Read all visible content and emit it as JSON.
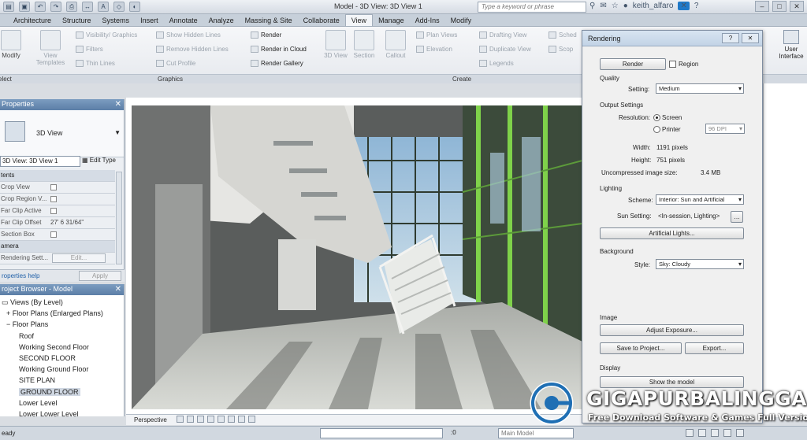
{
  "window": {
    "title": "Model - 3D View: 3D View 1",
    "search_placeholder": "Type a keyword or phrase",
    "user": "keith_alfaro"
  },
  "ribbon": {
    "tabs": [
      "Architecture",
      "Structure",
      "Systems",
      "Insert",
      "Annotate",
      "Analyze",
      "Massing & Site",
      "Collaborate",
      "View",
      "Manage",
      "Add-Ins",
      "Modify"
    ],
    "active_tab": "View",
    "left_cut": [
      "Modify",
      "elect"
    ],
    "graphics": {
      "label": "Graphics",
      "view_templates": "View Templates",
      "visibility": "Visibility/ Graphics",
      "filters": "Filters",
      "thin_lines": "Thin Lines",
      "show_hidden": "Show Hidden Lines",
      "remove_hidden": "Remove Hidden Lines",
      "cut_profile": "Cut Profile"
    },
    "render": {
      "render": "Render",
      "render_cloud": "Render in Cloud",
      "render_gallery": "Render Gallery"
    },
    "create": {
      "label": "Create",
      "view3d": "3D View",
      "section": "Section",
      "callout": "Callout",
      "plan_views": "Plan Views",
      "elevation": "Elevation",
      "drafting_view": "Drafting View",
      "duplicate_view": "Duplicate View",
      "legends": "Legends",
      "sched": "Sched",
      "scope": "Scop"
    },
    "user_interface": "User Interface"
  },
  "properties": {
    "title": "Properties",
    "type_name": "3D View",
    "view_selector": "3D View: 3D View 1",
    "edit_type": "Edit Type",
    "rows": [
      {
        "label": "tents",
        "kind": "cat"
      },
      {
        "label": "Crop View",
        "kind": "check"
      },
      {
        "label": "Crop Region V...",
        "kind": "check"
      },
      {
        "label": "Far Clip Active",
        "kind": "check"
      },
      {
        "label": "Far Clip Offset",
        "kind": "value",
        "value": "27' 6 31/64\""
      },
      {
        "label": "Section Box",
        "kind": "check"
      },
      {
        "label": "amera",
        "kind": "cat"
      },
      {
        "label": "Rendering Sett...",
        "kind": "button",
        "value": "Edit..."
      }
    ],
    "help_link": "roperties help",
    "apply": "Apply"
  },
  "browser": {
    "title": "roject Browser - Model",
    "items": [
      {
        "label": "Views (By Level)",
        "indent": 0,
        "prefix": "▭"
      },
      {
        "label": "Floor Plans (Enlarged Plans)",
        "indent": 1,
        "prefix": "+"
      },
      {
        "label": "Floor Plans",
        "indent": 1,
        "prefix": "−"
      },
      {
        "label": "Roof",
        "indent": 2
      },
      {
        "label": "Working Second Floor",
        "indent": 2
      },
      {
        "label": "SECOND FLOOR",
        "indent": 2
      },
      {
        "label": "Working Ground Floor",
        "indent": 2
      },
      {
        "label": "SITE PLAN",
        "indent": 2
      },
      {
        "label": "GROUND FLOOR",
        "indent": 2,
        "selected": true
      },
      {
        "label": "Lower Level",
        "indent": 2
      },
      {
        "label": "Lower Lower Level",
        "indent": 2
      }
    ]
  },
  "viewport": {
    "view_bar_label": "Perspective"
  },
  "rendering": {
    "title": "Rendering",
    "render_button": "Render",
    "region": "Region",
    "quality": {
      "section": "Quality",
      "setting_label": "Setting:",
      "setting": "Medium"
    },
    "output": {
      "section": "Output Settings",
      "resolution_label": "Resolution:",
      "screen": "Screen",
      "printer": "Printer",
      "dpi": "96 DPI",
      "width_label": "Width:",
      "width": "1191 pixels",
      "height_label": "Height:",
      "height": "751 pixels",
      "size_label": "Uncompressed image size:",
      "size": "3.4 MB"
    },
    "lighting": {
      "section": "Lighting",
      "scheme_label": "Scheme:",
      "scheme": "Interior: Sun and Artificial",
      "sun_label": "Sun Setting:",
      "sun": "<In-session, Lighting>",
      "artificial": "Artificial Lights..."
    },
    "background": {
      "section": "Background",
      "style_label": "Style:",
      "style": "Sky: Cloudy"
    },
    "image": {
      "section": "Image",
      "adjust": "Adjust Exposure...",
      "save": "Save to Project...",
      "export": "Export..."
    },
    "display": {
      "section": "Display",
      "show_model": "Show the model"
    }
  },
  "status": {
    "text": "eady",
    "zero": ":0",
    "model": "Main Model"
  },
  "watermark": {
    "brand1": "GIGA",
    "brand2": "PURBALINGGA",
    "tagline": "Free Download Software & Games Full Version"
  }
}
